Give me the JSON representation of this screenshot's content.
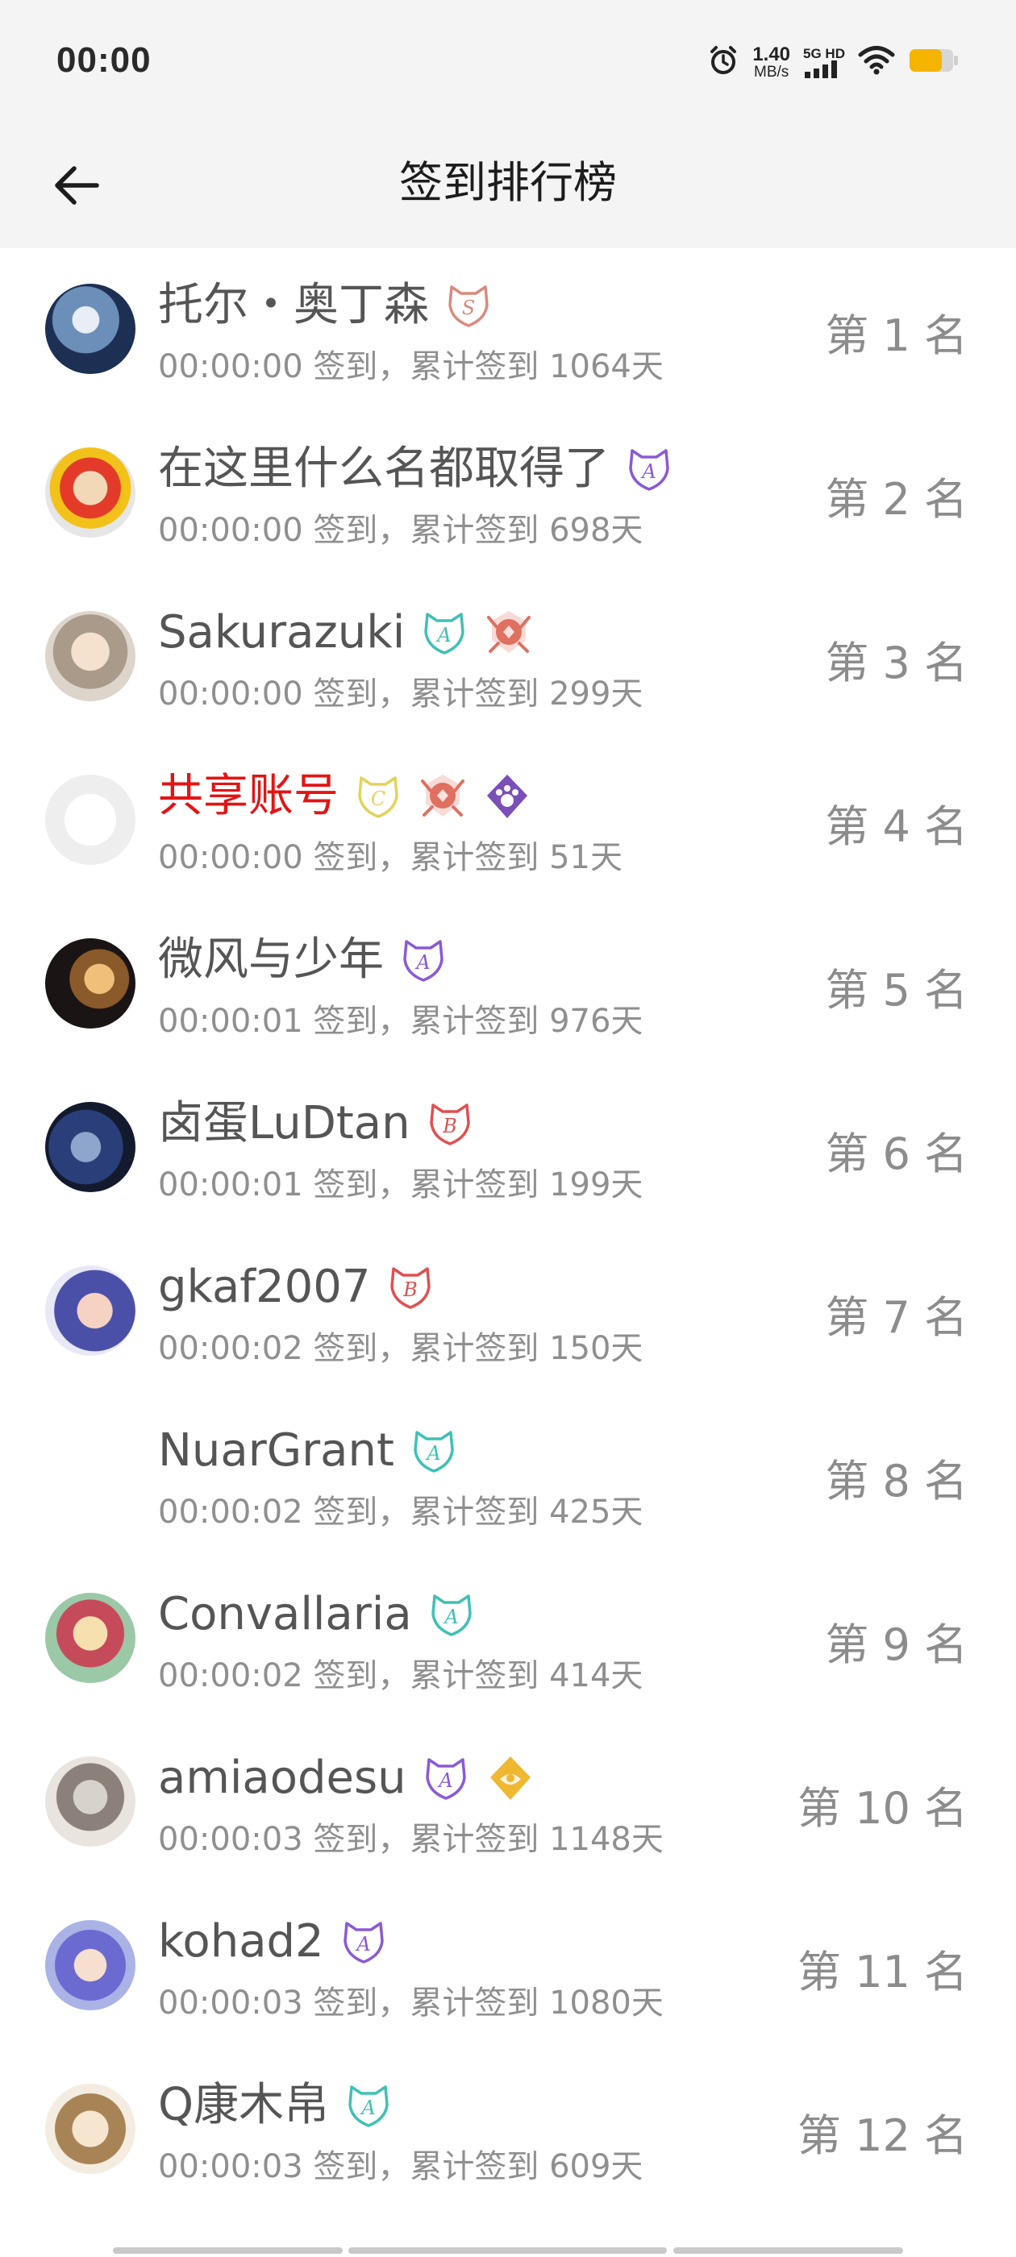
{
  "status_bar": {
    "time": "00:00",
    "net_speed_value": "1.40",
    "net_speed_unit": "MB/s",
    "signal_label": "5G HD",
    "battery_color": "#f5b400"
  },
  "header": {
    "back_icon": "arrow-left-icon",
    "title": "签到排行榜"
  },
  "rows": [
    {
      "name": "托尔・奥丁森",
      "sub": "00:00:00 签到，累计签到 1064天",
      "rank": "第 1 名",
      "badges": [
        {
          "icon": "badge-s-icon",
          "letter": "S",
          "color": "#d98a7c"
        }
      ]
    },
    {
      "name": "在这里什么名都取得了",
      "sub": "00:00:00 签到，累计签到 698天",
      "rank": "第 2 名",
      "badges": [
        {
          "icon": "badge-a-icon",
          "letter": "A",
          "color": "#8a5ad6"
        }
      ]
    },
    {
      "name": "Sakurazuki",
      "sub": "00:00:00 签到，累计签到 299天",
      "rank": "第 3 名",
      "badges": [
        {
          "icon": "badge-a-icon",
          "letter": "A",
          "color": "#3fc1b4"
        },
        {
          "icon": "medal-icon",
          "letter": "",
          "color": "#e07060"
        }
      ]
    },
    {
      "name": "共享账号",
      "sub": "00:00:00 签到，累计签到 51天",
      "rank": "第 4 名",
      "red": true,
      "badges": [
        {
          "icon": "badge-c-icon",
          "letter": "C",
          "color": "#e2d35a"
        },
        {
          "icon": "medal-icon",
          "letter": "",
          "color": "#e07060"
        },
        {
          "icon": "paw-badge-icon",
          "letter": "",
          "color": "#7b4fb8"
        }
      ]
    },
    {
      "name": "微风与少年",
      "sub": "00:00:01 签到，累计签到 976天",
      "rank": "第 5 名",
      "badges": [
        {
          "icon": "badge-a-icon",
          "letter": "A",
          "color": "#8a5ad6"
        }
      ]
    },
    {
      "name": "卤蛋LuDtan",
      "sub": "00:00:01 签到，累计签到 199天",
      "rank": "第 6 名",
      "badges": [
        {
          "icon": "badge-b-icon",
          "letter": "B",
          "color": "#e05050"
        }
      ]
    },
    {
      "name": "gkaf2007",
      "sub": "00:00:02 签到，累计签到 150天",
      "rank": "第 7 名",
      "badges": [
        {
          "icon": "badge-b-icon",
          "letter": "B",
          "color": "#e05050"
        }
      ]
    },
    {
      "name": "NuarGrant",
      "sub": "00:00:02 签到，累计签到 425天",
      "rank": "第 8 名",
      "badges": [
        {
          "icon": "badge-a-icon",
          "letter": "A",
          "color": "#3fc1b4"
        }
      ]
    },
    {
      "name": "Convallaria",
      "sub": "00:00:02 签到，累计签到 414天",
      "rank": "第 9 名",
      "badges": [
        {
          "icon": "badge-a-icon",
          "letter": "A",
          "color": "#3fc1b4"
        }
      ]
    },
    {
      "name": "amiaodesu",
      "sub": "00:00:03 签到，累计签到 1148天",
      "rank": "第 10 名",
      "badges": [
        {
          "icon": "badge-a-icon",
          "letter": "A",
          "color": "#8a5ad6"
        },
        {
          "icon": "gold-badge-icon",
          "letter": "",
          "color": "#f0b830"
        }
      ]
    },
    {
      "name": "kohad2",
      "sub": "00:00:03 签到，累计签到 1080天",
      "rank": "第 11 名",
      "badges": [
        {
          "icon": "badge-a-icon",
          "letter": "A",
          "color": "#8a5ad6"
        }
      ]
    },
    {
      "name": "Q康木帛",
      "sub": "00:00:03 签到，累计签到 609天",
      "rank": "第 12 名",
      "badges": [
        {
          "icon": "badge-a-icon",
          "letter": "A",
          "color": "#3fc1b4"
        }
      ]
    }
  ]
}
